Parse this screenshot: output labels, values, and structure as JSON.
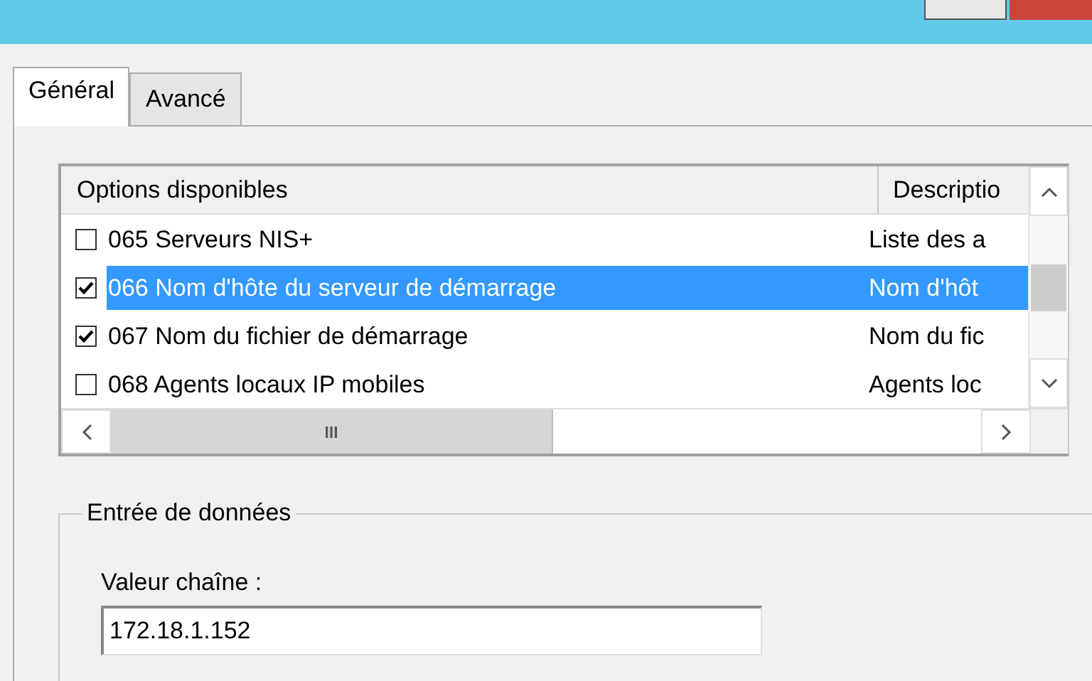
{
  "tabs": [
    {
      "label": "Général",
      "selected": true
    },
    {
      "label": "Avancé",
      "selected": false
    }
  ],
  "options_list": {
    "columns": [
      "Options disponibles",
      "Descriptio"
    ],
    "rows": [
      {
        "option": "065 Serveurs NIS+",
        "description": "Liste des a",
        "checked": false,
        "selected": false
      },
      {
        "option": "066 Nom d'hôte du serveur de démarrage",
        "description": "Nom d'hôt",
        "checked": true,
        "selected": true
      },
      {
        "option": "067 Nom du fichier de démarrage",
        "description": "Nom du fic",
        "checked": true,
        "selected": false
      },
      {
        "option": "068 Agents locaux IP mobiles",
        "description": "Agents loc",
        "checked": false,
        "selected": false
      }
    ]
  },
  "data_entry": {
    "title": "Entrée de données",
    "label": "Valeur chaîne :",
    "value": "172.18.1.152"
  }
}
